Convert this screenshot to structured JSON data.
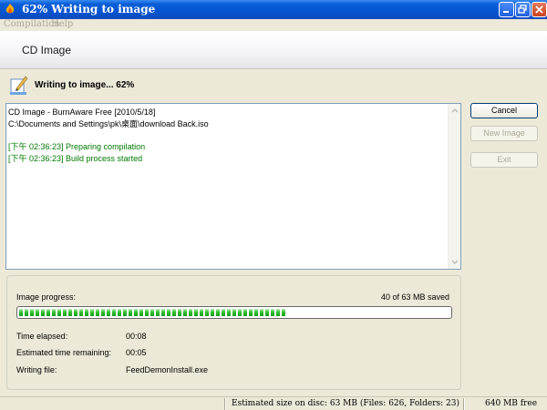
{
  "window": {
    "title": "62% Writing to image",
    "icon": "burnaware-flame-icon"
  },
  "menu": [
    "Compilation",
    "Help"
  ],
  "header": {
    "title": "CD Image"
  },
  "status": {
    "text": "Writing to image... 62%",
    "icon": "write-document-icon"
  },
  "log": {
    "lines": [
      {
        "text": "CD Image - BurnAware Free [2010/5/18]",
        "style": "normal"
      },
      {
        "text": "C:\\Documents and Settings\\pk\\桌面\\download Back.iso",
        "style": "normal"
      },
      {
        "text": "",
        "style": "gap"
      },
      {
        "text": "[下午 02:36:23] Preparing compilation",
        "style": "green"
      },
      {
        "text": "[下午 02:36:23] Build process started",
        "style": "green"
      }
    ]
  },
  "buttons": {
    "cancel": "Cancel",
    "new_image": "New Image",
    "exit": "Exit"
  },
  "progress": {
    "label": "Image progress:",
    "saved": "40 of 63 MB saved",
    "fraction": 0.62
  },
  "details": {
    "elapsed_label": "Time elapsed:",
    "elapsed_value": "00:08",
    "remaining_label": "Estimated time remaining:",
    "remaining_value": "00:05",
    "file_label": "Writing file:",
    "file_value": "FeedDemonInstall.exe"
  },
  "statusbar": {
    "estimated": "Estimated size on disc: 63 MB (Files: 626, Folders: 23)",
    "free": "640 MB free"
  },
  "colors": {
    "titlebar": "#0654d0",
    "progress_fill": "#2fc02f",
    "log_green": "#007a00"
  }
}
